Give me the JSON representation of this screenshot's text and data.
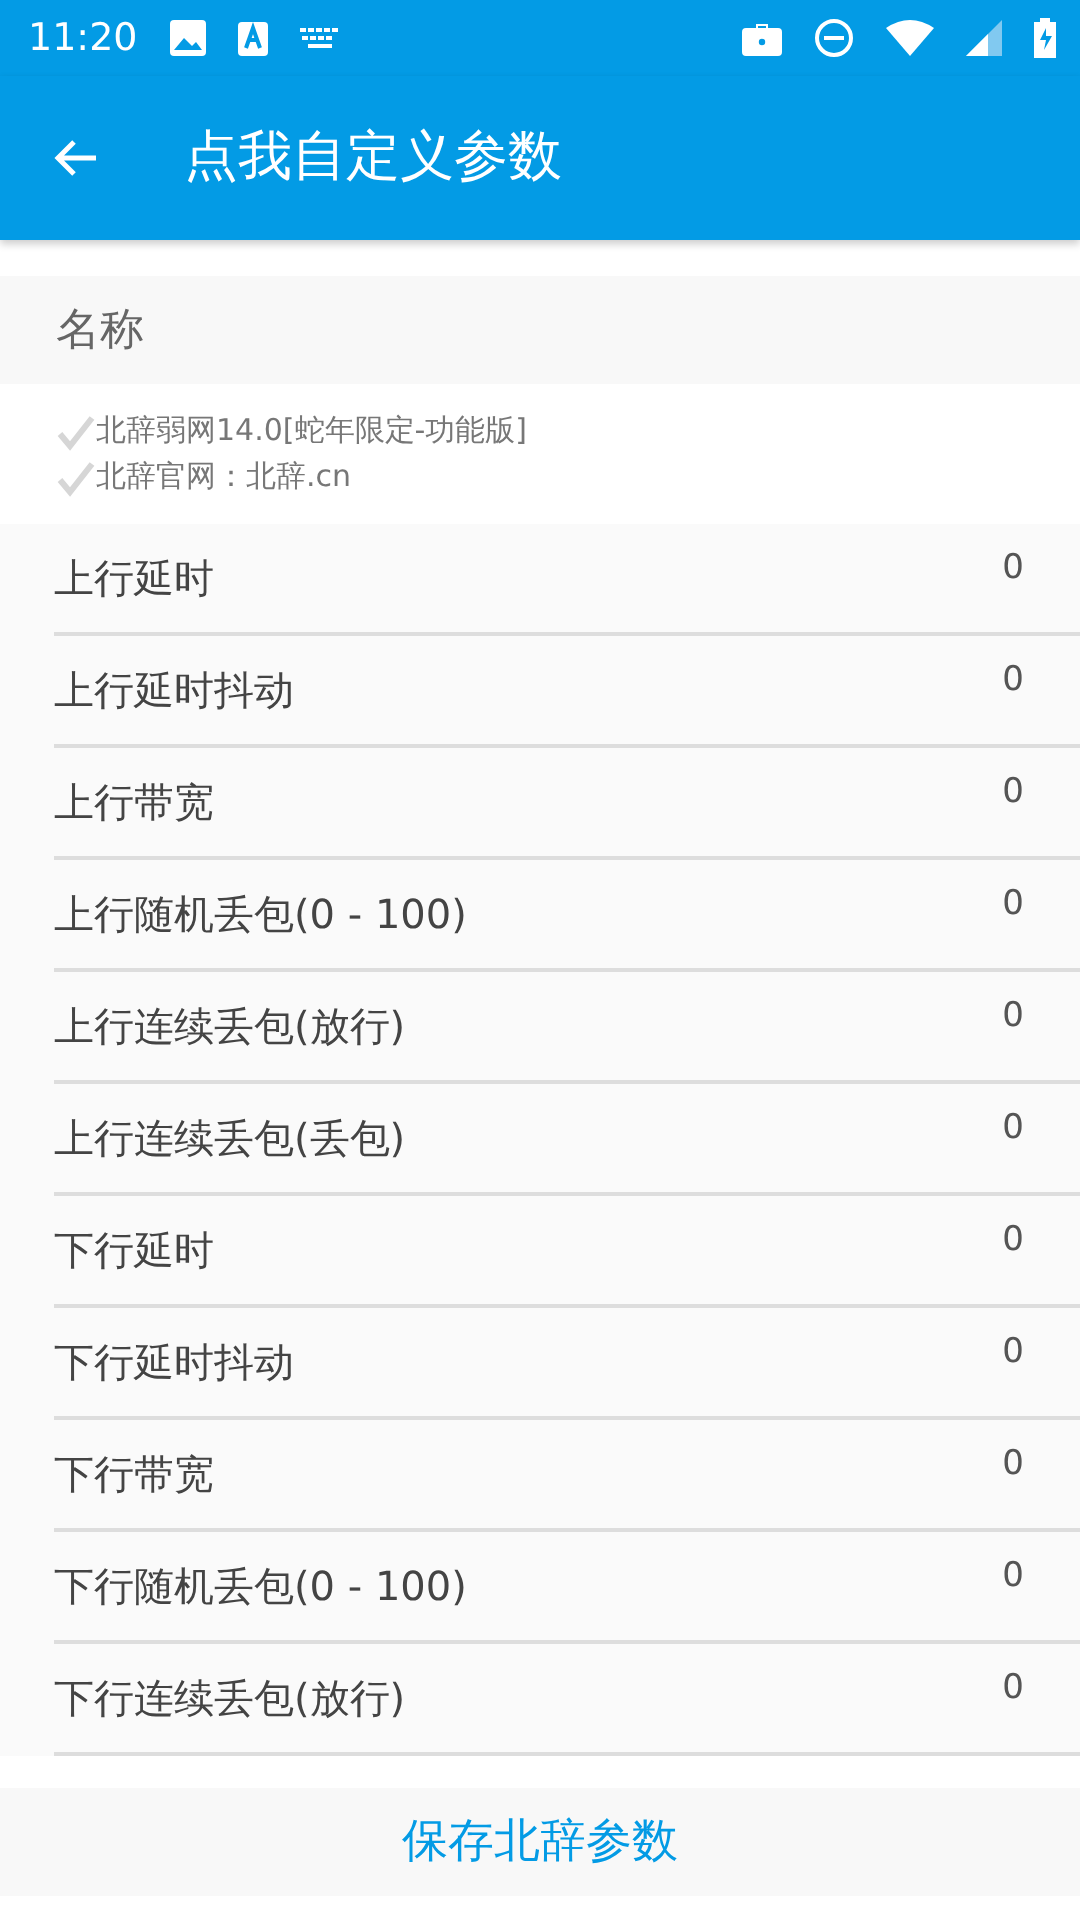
{
  "status_bar": {
    "time": "11:20"
  },
  "app_bar": {
    "title": "点我自定义参数"
  },
  "name_row": {
    "label": "名称"
  },
  "info_lines": [
    {
      "text": "北辞弱网14.0[蛇年限定-功能版]",
      "checked": true
    },
    {
      "text": "北辞官网：北辞.cn",
      "checked": true
    }
  ],
  "params": [
    {
      "label": "上行延时",
      "value": "0"
    },
    {
      "label": "上行延时抖动",
      "value": "0"
    },
    {
      "label": "上行带宽",
      "value": "0"
    },
    {
      "label": "上行随机丢包(0 - 100)",
      "value": "0"
    },
    {
      "label": "上行连续丢包(放行)",
      "value": "0"
    },
    {
      "label": "上行连续丢包(丢包)",
      "value": "0"
    },
    {
      "label": "下行延时",
      "value": "0"
    },
    {
      "label": "下行延时抖动",
      "value": "0"
    },
    {
      "label": "下行带宽",
      "value": "0"
    },
    {
      "label": "下行随机丢包(0 - 100)",
      "value": "0"
    },
    {
      "label": "下行连续丢包(放行)",
      "value": "0"
    }
  ],
  "save_button": {
    "label": "保存北辞参数"
  }
}
